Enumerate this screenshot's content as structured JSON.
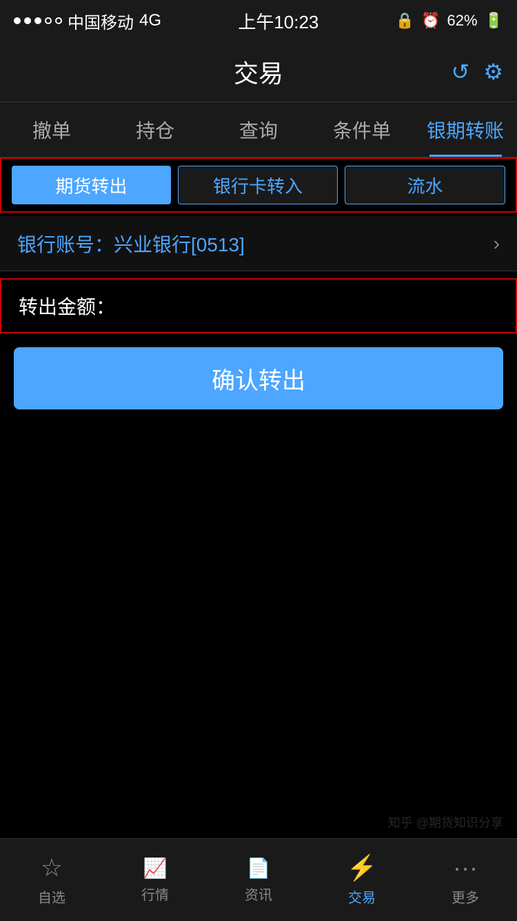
{
  "statusBar": {
    "carrier": "中国移动",
    "network": "4G",
    "time": "上午10:23",
    "battery": "62%"
  },
  "titleBar": {
    "title": "交易",
    "refreshLabel": "↺",
    "settingsLabel": "⚙"
  },
  "navTabs": [
    {
      "id": "撤单",
      "label": "撤单",
      "active": false
    },
    {
      "id": "持仓",
      "label": "持仓",
      "active": false
    },
    {
      "id": "查询",
      "label": "查询",
      "active": false
    },
    {
      "id": "条件单",
      "label": "条件单",
      "active": false
    },
    {
      "id": "银期转账",
      "label": "银期转账",
      "active": true
    }
  ],
  "subTabs": [
    {
      "id": "期货转出",
      "label": "期货转出",
      "active": true
    },
    {
      "id": "银行卡转入",
      "label": "银行卡转入",
      "active": false
    },
    {
      "id": "流水",
      "label": "流水",
      "active": false
    }
  ],
  "bankAccount": {
    "label": "银行账号：兴业银行",
    "number": "[0513]"
  },
  "amountField": {
    "label": "转出金额：",
    "placeholder": "",
    "value": ""
  },
  "confirmButton": {
    "label": "确认转出"
  },
  "bottomNav": [
    {
      "id": "自选",
      "label": "自选",
      "icon": "☆",
      "active": false
    },
    {
      "id": "行情",
      "label": "行情",
      "icon": "📈",
      "active": false
    },
    {
      "id": "资讯",
      "label": "资讯",
      "icon": "📄",
      "active": false
    },
    {
      "id": "交易",
      "label": "交易",
      "icon": "⚡",
      "active": true
    },
    {
      "id": "更多",
      "label": "更多",
      "icon": "···",
      "active": false
    }
  ],
  "watermark": "知乎 @期货知识分享"
}
